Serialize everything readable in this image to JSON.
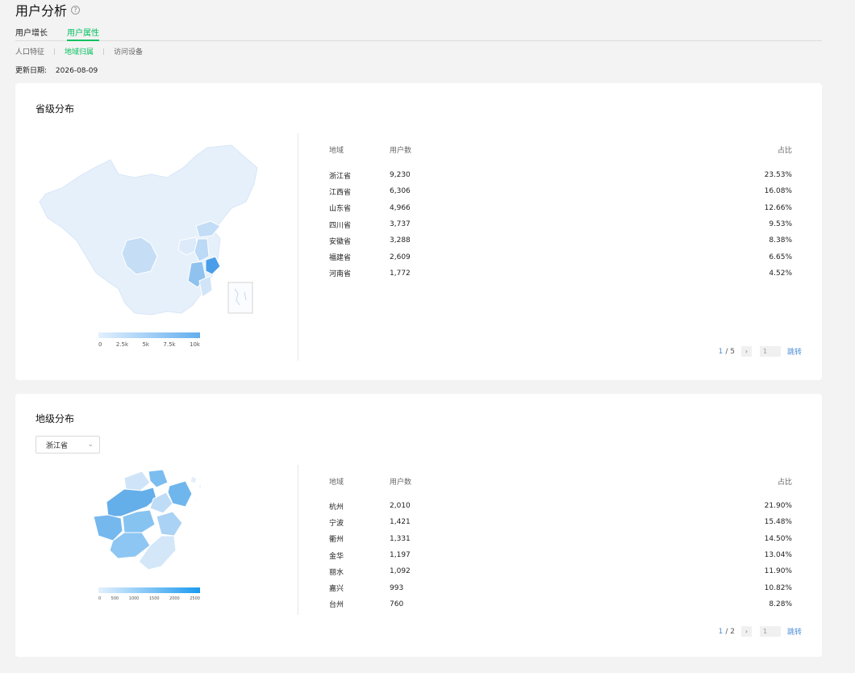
{
  "header": {
    "title": "用户分析",
    "help_icon": "?",
    "tabs": [
      {
        "label": "用户增长",
        "active": false
      },
      {
        "label": "用户属性",
        "active": true
      }
    ],
    "sub_tabs": [
      {
        "label": "人口特征",
        "active": false
      },
      {
        "label": "地域归属",
        "active": true
      },
      {
        "label": "访问设备",
        "active": false
      }
    ],
    "update_label": "更新日期:",
    "update_date": "2026-08-09"
  },
  "province": {
    "title": "省级分布",
    "legend_ticks": [
      "0",
      "2.5k",
      "5k",
      "7.5k",
      "10k"
    ],
    "columns": {
      "region": "地域",
      "users": "用户数",
      "pct": "占比"
    },
    "rows": [
      {
        "region": "浙江省",
        "users": "9,230",
        "pct": "23.53%"
      },
      {
        "region": "江西省",
        "users": "6,306",
        "pct": "16.08%"
      },
      {
        "region": "山东省",
        "users": "4,966",
        "pct": "12.66%"
      },
      {
        "region": "四川省",
        "users": "3,737",
        "pct": "9.53%"
      },
      {
        "region": "安徽省",
        "users": "3,288",
        "pct": "8.38%"
      },
      {
        "region": "福建省",
        "users": "2,609",
        "pct": "6.65%"
      },
      {
        "region": "河南省",
        "users": "1,772",
        "pct": "4.52%"
      }
    ],
    "pager": {
      "current": "1",
      "total": "/ 5",
      "next": "›",
      "input": "1",
      "jump": "跳转"
    }
  },
  "city": {
    "title": "地级分布",
    "select_value": "浙江省",
    "legend_ticks": [
      "0",
      "500",
      "1000",
      "1500",
      "2000",
      "2500"
    ],
    "columns": {
      "region": "地域",
      "users": "用户数",
      "pct": "占比"
    },
    "rows": [
      {
        "region": "杭州",
        "users": "2,010",
        "pct": "21.90%"
      },
      {
        "region": "宁波",
        "users": "1,421",
        "pct": "15.48%"
      },
      {
        "region": "衢州",
        "users": "1,331",
        "pct": "14.50%"
      },
      {
        "region": "金华",
        "users": "1,197",
        "pct": "13.04%"
      },
      {
        "region": "丽水",
        "users": "1,092",
        "pct": "11.90%"
      },
      {
        "region": "嘉兴",
        "users": "993",
        "pct": "10.82%"
      },
      {
        "region": "台州",
        "users": "760",
        "pct": "8.28%"
      }
    ],
    "pager": {
      "current": "1",
      "total": "/ 2",
      "next": "›",
      "input": "1",
      "jump": "跳转"
    }
  },
  "colors": {
    "accent": "#07c160",
    "map_light": "#e8f1fb",
    "map_dark": "#4fa3ea"
  }
}
